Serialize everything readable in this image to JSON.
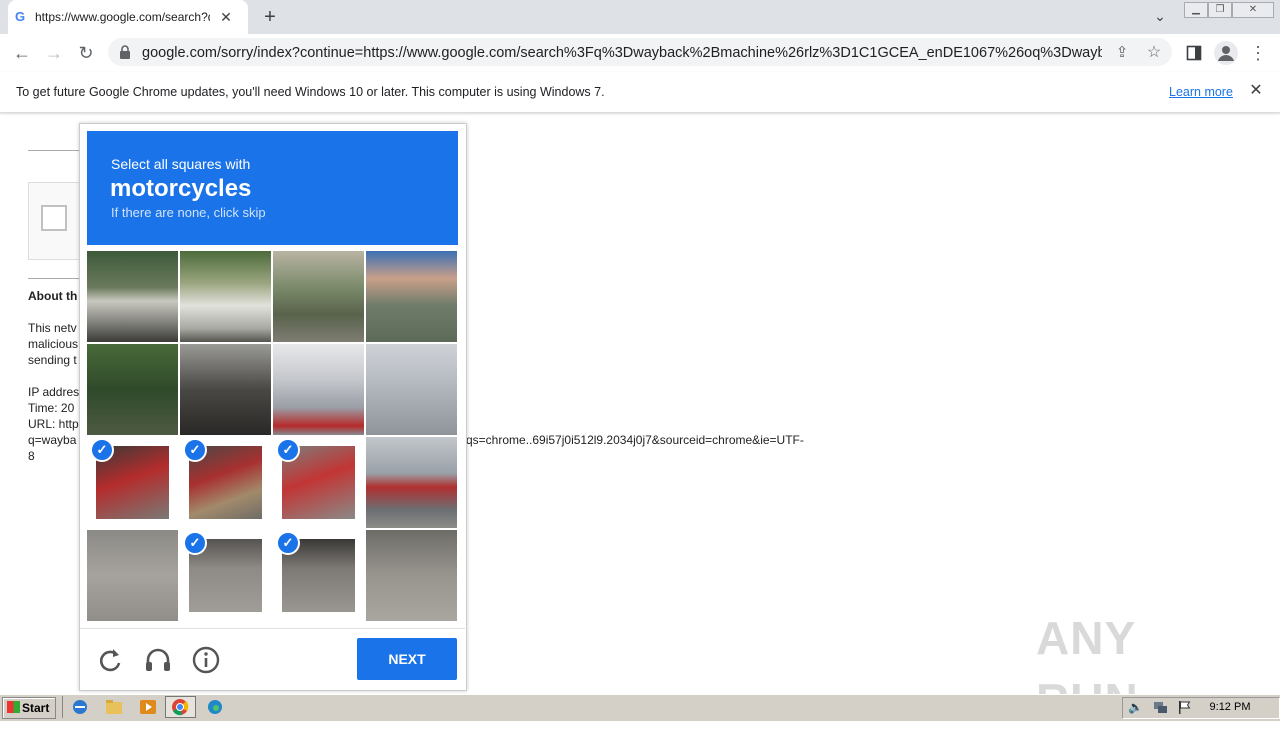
{
  "browser": {
    "tab": {
      "favicon": "G",
      "title": "https://www.google.com/search?q=",
      "close_icon": "close-icon"
    },
    "new_tab_icon": "plus-icon",
    "url": "google.com/sorry/index?continue=https://www.google.com/search%3Fq%3Dwayback%2Bmachine%26rlz%3D1C1GCEA_enDE1067%26oq%3Dwayba...",
    "infobar": {
      "message": "To get future Google Chrome updates, you'll need Windows 10 or later. This computer is using Windows 7.",
      "link": "Learn more"
    }
  },
  "page": {
    "about_heading": "About th",
    "body_lines": [
      "This netv",
      "malicious",
      "sending t"
    ],
    "ip_label": "IP addres",
    "time_label": "Time: 20",
    "url_label": "URL: http",
    "url_line2": "q=wayba",
    "url_tail": "qs=chrome..69i57j0i512l9.2034j0j7&sourceid=chrome&ie=UTF-",
    "url_end": "8"
  },
  "captcha": {
    "instruction": "Select all squares with",
    "target": "motorcycles",
    "hint": "If there are none, click skip",
    "selected_tiles": [
      9,
      10,
      11,
      14,
      15
    ],
    "next_label": "NEXT",
    "icons": [
      "reload-icon",
      "headphones-icon",
      "info-icon"
    ]
  },
  "taskbar": {
    "start_label": "Start",
    "clock": "9:12 PM"
  },
  "watermark": "ANY RUN",
  "colors": {
    "accent": "#1a73e8",
    "taskbar": "#d4d0c8"
  }
}
